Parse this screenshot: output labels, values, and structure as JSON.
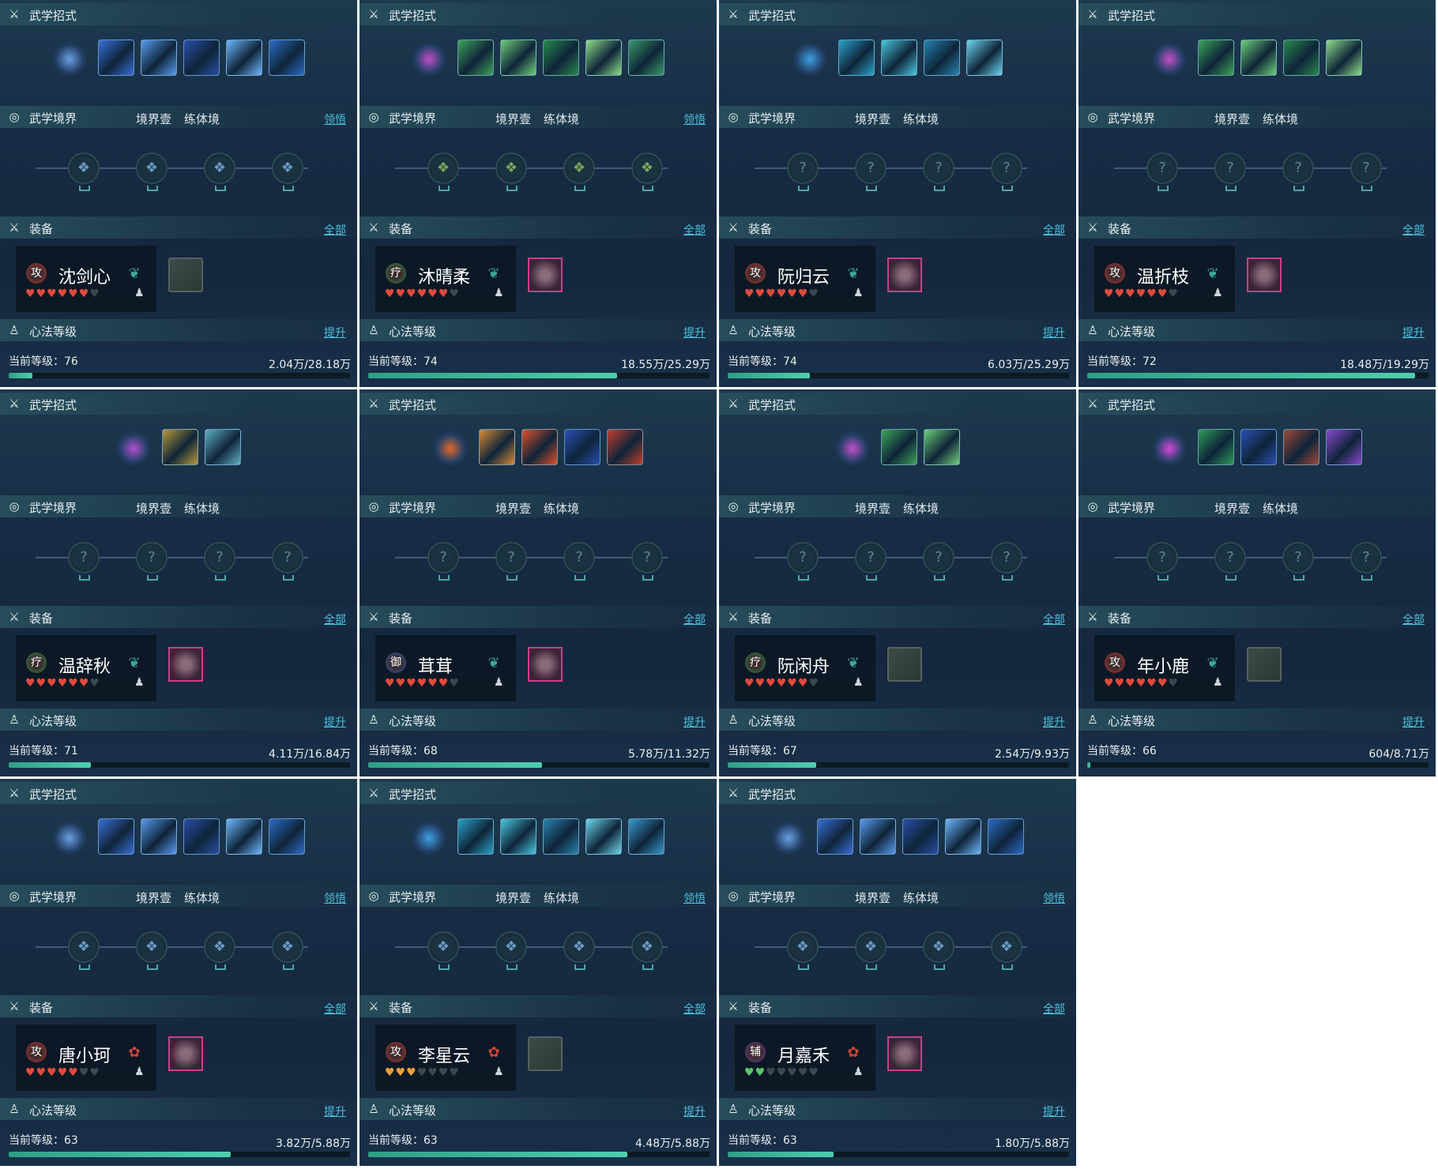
{
  "labels": {
    "skills_title": "武学招式",
    "realm_title": "武学境界",
    "realm_stage": "境界壹",
    "realm_level": "练体境",
    "realm_link": "领悟",
    "equip_title": "装备",
    "equip_link": "全部",
    "heart_title": "心法等级",
    "heart_link": "提升",
    "level_prefix": "当前等级："
  },
  "colors": {
    "accent_link": "#4cc2df",
    "progress_fill": "#4fcfae",
    "heart_on": "#e34a3c",
    "attack_badge": "#b83838",
    "heal_badge": "#2f8a4c",
    "defend_badge": "#2e5aa8",
    "support_badge": "#6a3a9a"
  },
  "characters": [
    {
      "name": "沈剑心",
      "badge": "攻",
      "role": "attack",
      "element": "jade-leaf-icon",
      "hearts_on": 6,
      "hearts_total": 7,
      "heart_color": "red",
      "equip": "empty",
      "level": "76",
      "exp": "2.04万/28.18万",
      "progress": 0.07,
      "skill_count": 5,
      "skill_palette": "blue",
      "realm_link": true
    },
    {
      "name": "沐晴柔",
      "badge": "疗",
      "role": "heal",
      "element": "jade-leaf-icon",
      "hearts_on": 6,
      "hearts_total": 7,
      "heart_color": "red",
      "equip": "item",
      "level": "74",
      "exp": "18.55万/25.29万",
      "progress": 0.73,
      "skill_count": 5,
      "skill_palette": "green",
      "realm_link": true
    },
    {
      "name": "阮归云",
      "badge": "攻",
      "role": "attack",
      "element": "jade-leaf-icon",
      "hearts_on": 6,
      "hearts_total": 7,
      "heart_color": "red",
      "equip": "item",
      "level": "74",
      "exp": "6.03万/25.29万",
      "progress": 0.24,
      "skill_count": 4,
      "skill_palette": "cyan",
      "realm_link": false
    },
    {
      "name": "温折枝",
      "badge": "攻",
      "role": "attack",
      "element": "jade-leaf-icon",
      "hearts_on": 6,
      "hearts_total": 7,
      "heart_color": "red",
      "equip": "item",
      "level": "72",
      "exp": "18.48万/19.29万",
      "progress": 0.96,
      "skill_count": 4,
      "skill_palette": "green",
      "realm_link": false
    },
    {
      "name": "温辞秋",
      "badge": "疗",
      "role": "heal",
      "element": "jade-leaf-icon",
      "hearts_on": 6,
      "hearts_total": 7,
      "heart_color": "red",
      "equip": "item",
      "level": "71",
      "exp": "4.11万/16.84万",
      "progress": 0.24,
      "skill_count": 2,
      "skill_palette": "gold",
      "realm_link": false
    },
    {
      "name": "茸茸",
      "badge": "御",
      "role": "defend",
      "element": "jade-leaf-icon",
      "hearts_on": 6,
      "hearts_total": 7,
      "heart_color": "red",
      "equip": "item",
      "level": "68",
      "exp": "5.78万/11.32万",
      "progress": 0.51,
      "skill_count": 4,
      "skill_palette": "fire",
      "realm_link": false
    },
    {
      "name": "阮闲舟",
      "badge": "疗",
      "role": "heal",
      "element": "jade-leaf-icon",
      "hearts_on": 6,
      "hearts_total": 7,
      "heart_color": "red",
      "equip": "empty",
      "level": "67",
      "exp": "2.54万/9.93万",
      "progress": 0.26,
      "skill_count": 2,
      "skill_palette": "green",
      "realm_link": false
    },
    {
      "name": "年小鹿",
      "badge": "攻",
      "role": "attack",
      "element": "jade-leaf-icon",
      "hearts_on": 6,
      "hearts_total": 7,
      "heart_color": "red",
      "equip": "empty",
      "level": "66",
      "exp": "604/8.71万",
      "progress": 0.01,
      "skill_count": 4,
      "skill_palette": "purple",
      "realm_link": false
    },
    {
      "name": "唐小珂",
      "badge": "攻",
      "role": "attack",
      "element": "red-flower-icon",
      "hearts_on": 5,
      "hearts_total": 7,
      "heart_color": "red",
      "equip": "item",
      "level": "63",
      "exp": "3.82万/5.88万",
      "progress": 0.65,
      "skill_count": 5,
      "skill_palette": "blue",
      "realm_link": true
    },
    {
      "name": "李星云",
      "badge": "攻",
      "role": "attack",
      "element": "red-flower-icon",
      "hearts_on": 3,
      "hearts_total": 7,
      "heart_color": "gold",
      "equip": "empty",
      "level": "63",
      "exp": "4.48万/5.88万",
      "progress": 0.76,
      "skill_count": 5,
      "skill_palette": "cyan",
      "realm_link": true
    },
    {
      "name": "月嘉禾",
      "badge": "辅",
      "role": "support",
      "element": "red-flower-icon",
      "hearts_on": 2,
      "hearts_total": 7,
      "heart_color": "green",
      "equip": "item",
      "level": "63",
      "exp": "1.80万/5.88万",
      "progress": 0.31,
      "skill_count": 5,
      "skill_palette": "blue",
      "realm_link": true
    }
  ]
}
